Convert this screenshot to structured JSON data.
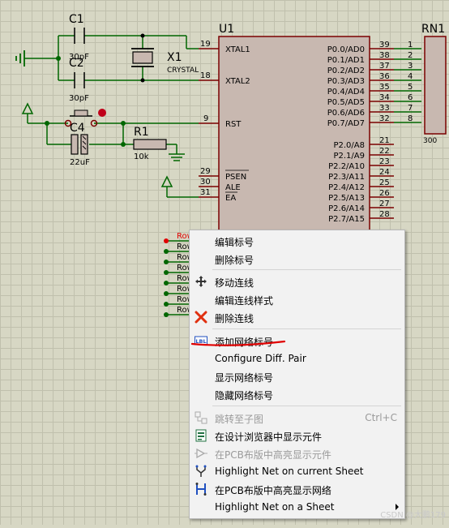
{
  "schematic": {
    "u1_ref": "U1",
    "rn1_ref": "RN1",
    "rn1_value": "300",
    "c1_ref": "C1",
    "c1_value": "30pF",
    "c2_ref": "C2",
    "c2_value": "30pF",
    "x1_ref": "X1",
    "x1_value": "CRYSTAL",
    "c4_ref": "C4",
    "c4_value": "22uF",
    "r1_ref": "R1",
    "r1_value": "10k",
    "left_pins": [
      {
        "num": "19",
        "name": "XTAL1"
      },
      {
        "num": "18",
        "name": "XTAL2"
      },
      {
        "num": "9",
        "name": "RST"
      },
      {
        "num": "29",
        "name": "PSEN"
      },
      {
        "num": "30",
        "name": "ALE"
      },
      {
        "num": "31",
        "name": "EA"
      }
    ],
    "p0_pins": [
      {
        "num": "39",
        "name": "P0.0/AD0",
        "rn": "1"
      },
      {
        "num": "38",
        "name": "P0.1/AD1",
        "rn": "2"
      },
      {
        "num": "37",
        "name": "P0.2/AD2",
        "rn": "3"
      },
      {
        "num": "36",
        "name": "P0.3/AD3",
        "rn": "4"
      },
      {
        "num": "35",
        "name": "P0.4/AD4",
        "rn": "5"
      },
      {
        "num": "34",
        "name": "P0.5/AD5",
        "rn": "6"
      },
      {
        "num": "33",
        "name": "P0.6/AD6",
        "rn": "7"
      },
      {
        "num": "32",
        "name": "P0.7/AD7",
        "rn": "8"
      }
    ],
    "p2_pins": [
      {
        "num": "21",
        "name": "P2.0/A8"
      },
      {
        "num": "22",
        "name": "P2.1/A9"
      },
      {
        "num": "23",
        "name": "P2.2/A10"
      },
      {
        "num": "24",
        "name": "P2.3/A11"
      },
      {
        "num": "25",
        "name": "P2.4/A12"
      },
      {
        "num": "26",
        "name": "P2.5/A13"
      },
      {
        "num": "27",
        "name": "P2.6/A14"
      },
      {
        "num": "28",
        "name": "P2.7/A15"
      }
    ],
    "row_labels": [
      "Row",
      "Row",
      "Row",
      "Row",
      "Row",
      "Row",
      "Row",
      "Row"
    ]
  },
  "context_menu": {
    "items": [
      {
        "label": "编辑标号",
        "icon": "",
        "disabled": false
      },
      {
        "label": "删除标号",
        "icon": "",
        "disabled": false
      },
      {
        "label": "移动连线",
        "icon": "move-icon",
        "disabled": false
      },
      {
        "label": "编辑连线样式",
        "icon": "",
        "disabled": false
      },
      {
        "label": "删除连线",
        "icon": "delete-x-icon",
        "disabled": false
      },
      {
        "label": "添加网络标号",
        "icon": "lbl-icon",
        "disabled": false
      },
      {
        "label": "Configure Diff. Pair",
        "icon": "",
        "disabled": false
      },
      {
        "label": "显示网络标号",
        "icon": "",
        "disabled": false
      },
      {
        "label": "隐藏网络标号",
        "icon": "",
        "disabled": false
      },
      {
        "label": "跳转至子图",
        "icon": "subsheet-icon",
        "disabled": true,
        "shortcut": "Ctrl+C"
      },
      {
        "label": "在设计浏览器中显示元件",
        "icon": "browser-icon",
        "disabled": false
      },
      {
        "label": "在PCB布版中高亮显示元件",
        "icon": "pcb-component-icon",
        "disabled": true
      },
      {
        "label": "Highlight Net on current Sheet",
        "icon": "net-highlight-icon",
        "disabled": false
      },
      {
        "label": "在PCB布版中高亮显示网络",
        "icon": "pcb-net-icon",
        "disabled": false
      },
      {
        "label": "Highlight Net on a Sheet",
        "icon": "",
        "disabled": false,
        "submenu": true
      }
    ]
  },
  "watermark": "CSDN @大鹏179",
  "colors": {
    "grid_bg": "#d7d7c4",
    "component_fill": "#c8b8b0",
    "wire": "#006600",
    "pin": "#7a0000",
    "highlight_underline": "#e00000"
  }
}
